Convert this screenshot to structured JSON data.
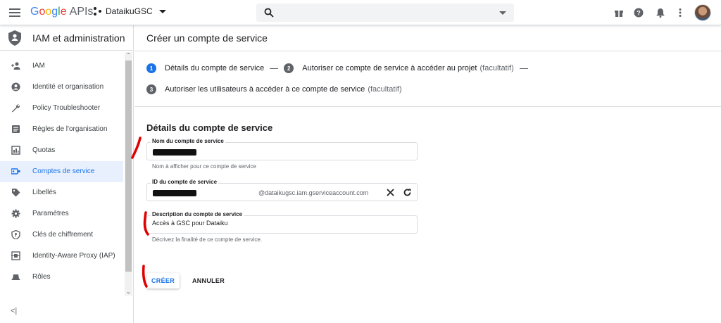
{
  "app": {
    "logo_google": "Google",
    "logo_apis": "APIs",
    "project_name": "DataikuGSC",
    "search_placeholder": ""
  },
  "sidebar": {
    "title": "IAM et administration",
    "items": [
      {
        "label": "IAM",
        "icon": "person-add-icon",
        "active": false
      },
      {
        "label": "Identité et organisation",
        "icon": "account-circle-icon",
        "active": false
      },
      {
        "label": "Policy Troubleshooter",
        "icon": "wrench-icon",
        "active": false
      },
      {
        "label": "Règles de l'organisation",
        "icon": "list-box-icon",
        "active": false
      },
      {
        "label": "Quotas",
        "icon": "quota-icon",
        "active": false
      },
      {
        "label": "Comptes de service",
        "icon": "service-account-icon",
        "active": true
      },
      {
        "label": "Libellés",
        "icon": "label-tag-icon",
        "active": false
      },
      {
        "label": "Paramètres",
        "icon": "gear-icon",
        "active": false
      },
      {
        "label": "Clés de chiffrement",
        "icon": "shield-key-icon",
        "active": false
      },
      {
        "label": "Identity-Aware Proxy (IAP)",
        "icon": "proxy-icon",
        "active": false
      },
      {
        "label": "Rôles",
        "icon": "roles-hat-icon",
        "active": false
      }
    ]
  },
  "page": {
    "title": "Créer un compte de service",
    "steps": [
      {
        "num": "1",
        "label": "Détails du compte de service",
        "optional": ""
      },
      {
        "num": "2",
        "label": "Autoriser ce compte de service à accéder au projet",
        "optional": "(facultatif)"
      },
      {
        "num": "3",
        "label": "Autoriser les utilisateurs à accéder à ce compte de service",
        "optional": "(facultatif)"
      }
    ],
    "section_title": "Détails du compte de service",
    "fields": {
      "name": {
        "label": "Nom du compte de service",
        "value": "",
        "help": "Nom à afficher pour ce compte de service"
      },
      "id": {
        "label": "ID du compte de service",
        "value": "",
        "suffix": "@dataikugsc.iam.gserviceaccount.com"
      },
      "description": {
        "label": "Description du compte de service",
        "value": "Accès à GSC pour Dataiku",
        "help": "Décrivez la finalité de ce compte de service."
      }
    },
    "buttons": {
      "create": "CRÉER",
      "cancel": "ANNULER"
    }
  },
  "colors": {
    "accent": "#1a73e8",
    "active_bg": "#e8f0fe",
    "annotation": "#e00000"
  }
}
